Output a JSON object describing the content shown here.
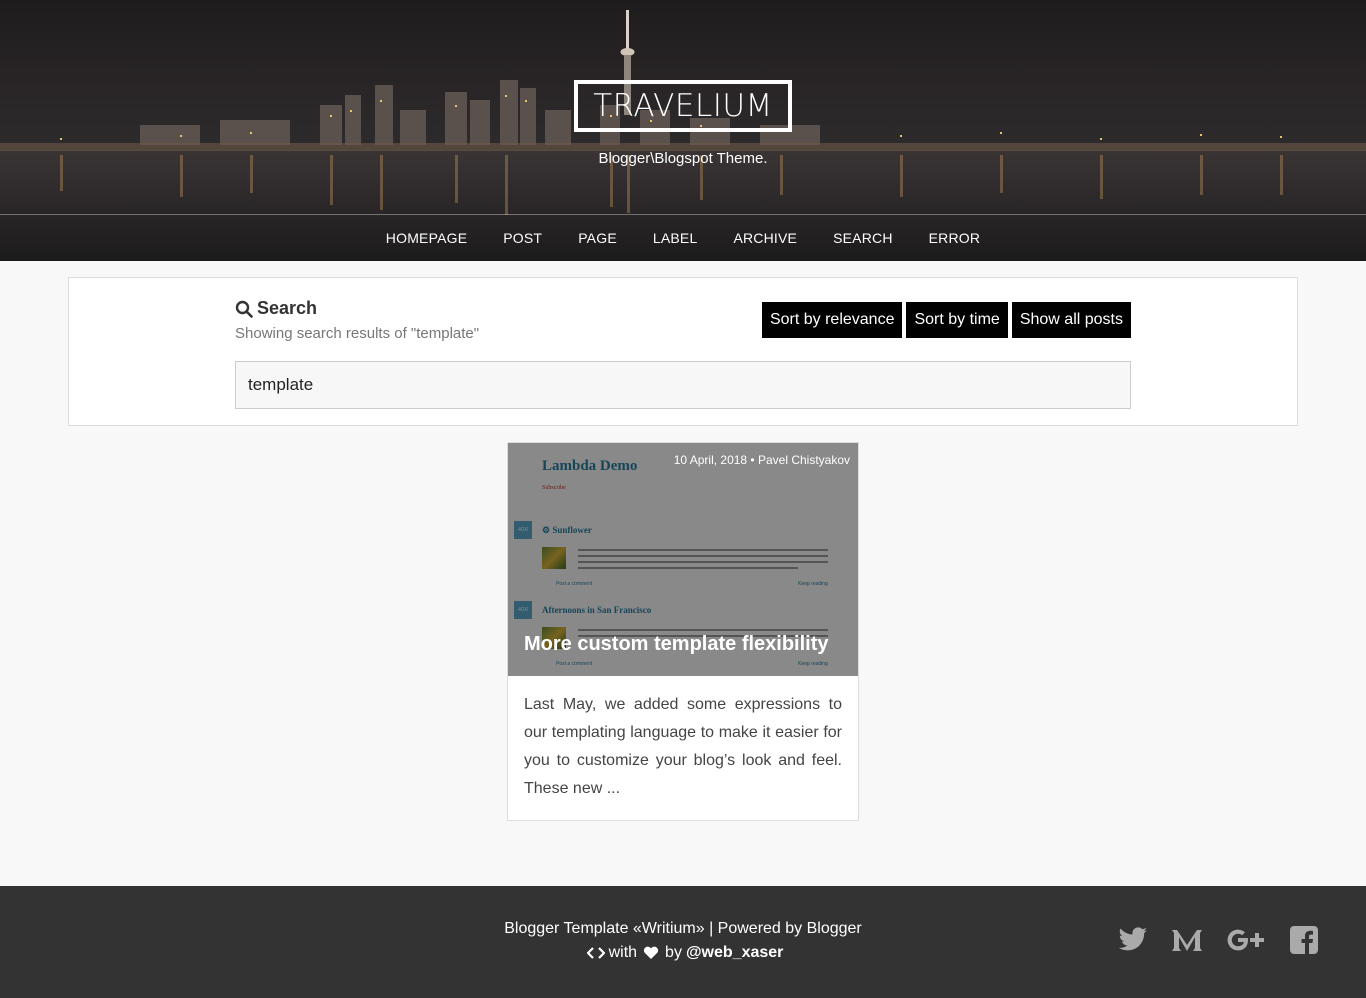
{
  "header": {
    "logo": "TRAVELIUM",
    "tagline": "Blogger\\Blogspot Theme.",
    "nav": [
      "HOMEPAGE",
      "POST",
      "PAGE",
      "LABEL",
      "ARCHIVE",
      "SEARCH",
      "ERROR"
    ]
  },
  "search": {
    "title": "Search",
    "subtitle": "Showing search results of \"template\"",
    "buttons": [
      "Sort by relevance",
      "Sort by time",
      "Show all posts"
    ],
    "value": "template"
  },
  "post": {
    "meta": "10 April, 2018 • Pavel Chistyakov",
    "title": "More custom template flexibility",
    "excerpt": "Last May, we added some expressions to our templating language to make it easier for you to customize your blog’s look and feel. These new ...",
    "thumbnail": {
      "blog_title": "Lambda Demo",
      "blog_sub": "Subscribe",
      "post1_title": "Sunflower",
      "post2_title": "Afternoons in San Francisco",
      "comment_link": "Post a comment",
      "read_link": "Keep reading"
    }
  },
  "footer": {
    "line1": "Blogger Template «Writium» | Powered by Blogger",
    "with": "with",
    "by": "by",
    "author": "@web_xaser",
    "social": [
      "twitter-icon",
      "medium-icon",
      "google-plus-icon",
      "facebook-icon"
    ]
  },
  "colors": {
    "button_bg": "#000000",
    "footer_bg": "#333333",
    "page_bg": "#f8f8f8",
    "thumb_link": "#2a7fa0"
  }
}
